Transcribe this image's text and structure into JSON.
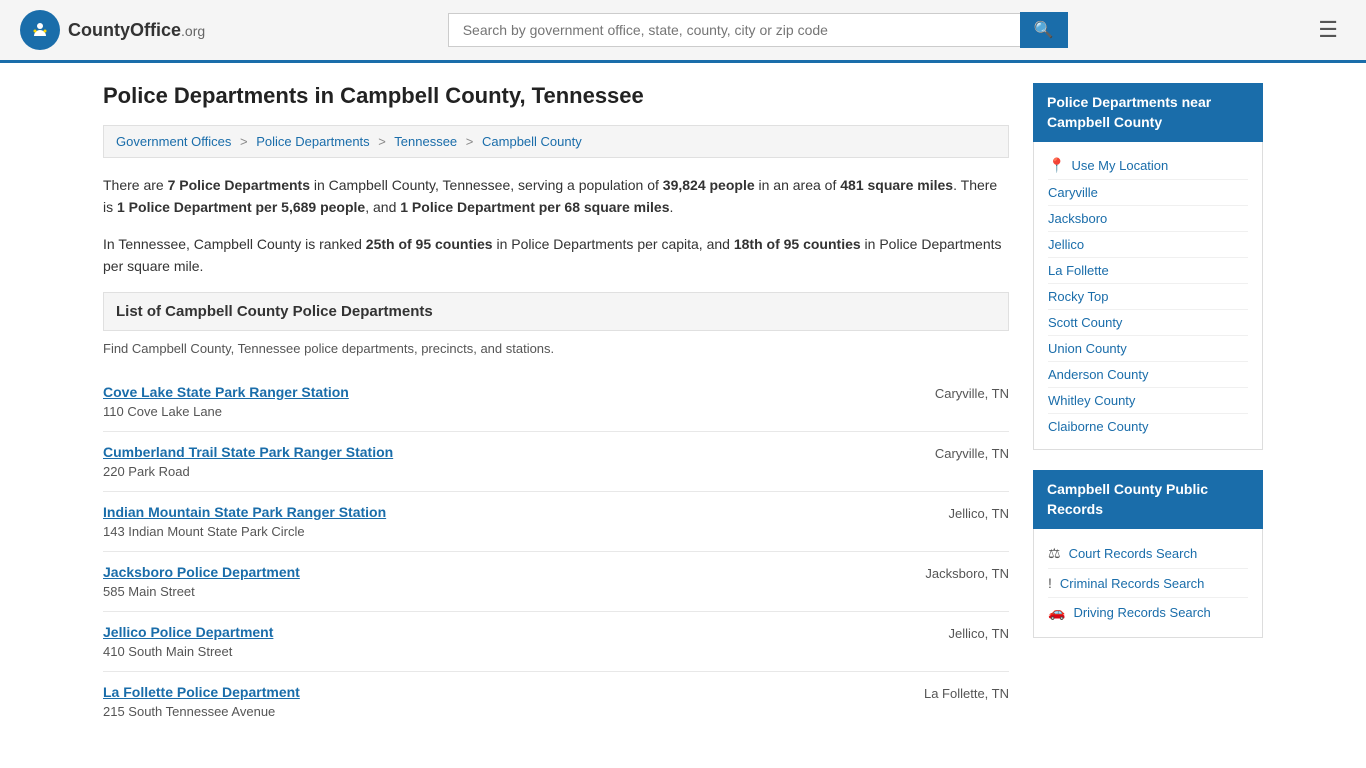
{
  "header": {
    "logo_text": "CountyOffice",
    "logo_org": ".org",
    "search_placeholder": "Search by government office, state, county, city or zip code",
    "search_value": ""
  },
  "page": {
    "title": "Police Departments in Campbell County, Tennessee"
  },
  "breadcrumb": {
    "items": [
      {
        "label": "Government Offices",
        "href": "#"
      },
      {
        "label": "Police Departments",
        "href": "#"
      },
      {
        "label": "Tennessee",
        "href": "#"
      },
      {
        "label": "Campbell County",
        "href": "#"
      }
    ]
  },
  "description": {
    "para1_prefix": "There are ",
    "dept_count": "7 Police Departments",
    "para1_mid": " in Campbell County, Tennessee, serving a population of ",
    "population": "39,824 people",
    "para1_mid2": " in an area of ",
    "area": "481 square miles",
    "para1_mid3": ". There is ",
    "per_capita": "1 Police Department per 5,689 people",
    "para1_mid4": ", and ",
    "per_area": "1 Police Department per 68 square miles",
    "para1_end": ".",
    "para2_prefix": "In Tennessee, Campbell County is ranked ",
    "rank_capita": "25th of 95 counties",
    "para2_mid": " in Police Departments per capita, and ",
    "rank_area": "18th of 95 counties",
    "para2_end": " in Police Departments per square mile."
  },
  "list_section": {
    "header": "List of Campbell County Police Departments",
    "subtitle": "Find Campbell County, Tennessee police departments, precincts, and stations."
  },
  "departments": [
    {
      "name": "Cove Lake State Park Ranger Station",
      "address": "110 Cove Lake Lane",
      "city": "Caryville, TN"
    },
    {
      "name": "Cumberland Trail State Park Ranger Station",
      "address": "220 Park Road",
      "city": "Caryville, TN"
    },
    {
      "name": "Indian Mountain State Park Ranger Station",
      "address": "143 Indian Mount State Park Circle",
      "city": "Jellico, TN"
    },
    {
      "name": "Jacksboro Police Department",
      "address": "585 Main Street",
      "city": "Jacksboro, TN"
    },
    {
      "name": "Jellico Police Department",
      "address": "410 South Main Street",
      "city": "Jellico, TN"
    },
    {
      "name": "La Follette Police Department",
      "address": "215 South Tennessee Avenue",
      "city": "La Follette, TN"
    }
  ],
  "sidebar": {
    "nearby_header": "Police Departments near Campbell County",
    "use_location_label": "Use My Location",
    "nearby_links": [
      "Caryville",
      "Jacksboro",
      "Jellico",
      "La Follette",
      "Rocky Top",
      "Scott County",
      "Union County",
      "Anderson County",
      "Whitley County",
      "Claiborne County"
    ],
    "public_records_header": "Campbell County Public Records",
    "public_records_links": [
      {
        "label": "Court Records Search",
        "icon": "⚖"
      },
      {
        "label": "Criminal Records Search",
        "icon": "!"
      },
      {
        "label": "Driving Records Search",
        "icon": "🚗"
      }
    ]
  }
}
